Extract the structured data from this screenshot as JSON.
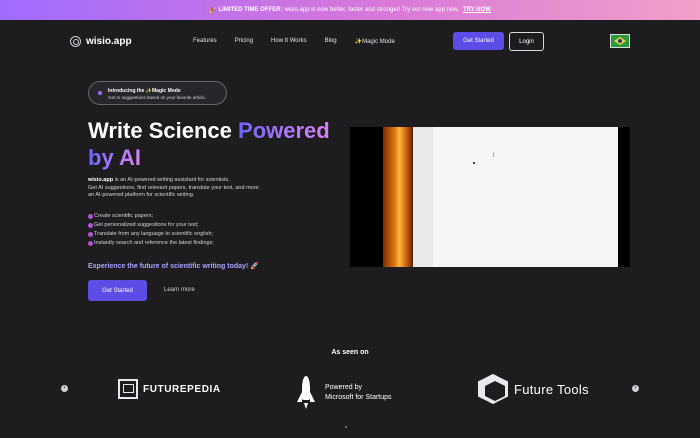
{
  "promo": {
    "emoji": "🎉",
    "label": "LIMITED TIME OFFER:",
    "text": "wisio.app is now better, faster and stronger! Try our new app now.",
    "link": "TRY NOW"
  },
  "nav": {
    "brand": "wisio.app",
    "links": [
      "Features",
      "Pricing",
      "How It Works",
      "Blog"
    ],
    "magic_icon": "✨",
    "magic_label": "Magic Mode",
    "get_started": "Get Started",
    "login": "Login",
    "flag_icon": "brazil-flag-icon"
  },
  "hero": {
    "intro_prefix": "Introducing the",
    "intro_icon": "✨",
    "intro_mode": "Magic Mode",
    "intro_sub": "Get AI suggestions based on your favorite article.",
    "headline_white": "Write Science",
    "headline_grad1": "Powered",
    "headline_grad2": "by AI",
    "desc_brand": "wisio.app",
    "desc_line1": "is an AI-powered writing assistant for scientists.",
    "desc_line2": "Get AI suggestions, find relevant papers, translate your text, and more.",
    "desc_line3": "an AI-powered platform for scientific writing.",
    "features": [
      "Create scientific papers;",
      "Get personalized suggestions for your text;",
      "Translate from any language to scientific english;",
      "Instantly search and reference the latest findings;"
    ],
    "experience": "Experience the future of scientific writing today! 🚀",
    "cta_start": "Get Started",
    "cta_learn": "Learn more"
  },
  "video": {
    "cursor": "I"
  },
  "seen_on": {
    "title": "As seen on",
    "prev": "‹",
    "next": "›",
    "futurepedia": "FUTUREPEDIA",
    "ms_line1": "Powered by",
    "ms_line2": "Microsoft for Startups",
    "future_tools": "Future Tools"
  },
  "colors": {
    "accent": "#5e4ce6",
    "background": "#1d1c1f",
    "promo_start": "#a06bff",
    "promo_end": "#f2a0c8"
  }
}
